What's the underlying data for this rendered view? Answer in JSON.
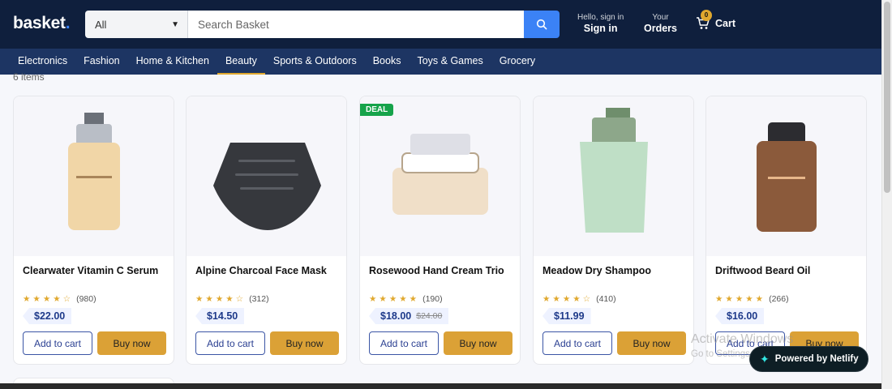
{
  "header": {
    "logo": "basket",
    "logo_dot": ".",
    "search_category": "All",
    "search_placeholder": "Search Basket",
    "account_small": "Hello, sign in",
    "account_big": "Sign in",
    "orders_small": "Your",
    "orders_big": "Orders",
    "cart_count": "0",
    "cart_label": "Cart"
  },
  "nav": {
    "items": [
      "Electronics",
      "Fashion",
      "Home & Kitchen",
      "Beauty",
      "Sports & Outdoors",
      "Books",
      "Toys & Games",
      "Grocery"
    ],
    "active": "Beauty"
  },
  "results": {
    "count_label": "6 items"
  },
  "products": [
    {
      "name": "Clearwater Vitamin C Serum",
      "rating": 4,
      "reviews": "(980)",
      "price": "$22.00",
      "old_price": "",
      "deal": false,
      "add_label": "Add to cart",
      "buy_label": "Buy now"
    },
    {
      "name": "Alpine Charcoal Face Mask",
      "rating": 4,
      "reviews": "(312)",
      "price": "$14.50",
      "old_price": "",
      "deal": false,
      "add_label": "Add to cart",
      "buy_label": "Buy now"
    },
    {
      "name": "Rosewood Hand Cream Trio",
      "rating": 5,
      "reviews": "(190)",
      "price": "$18.00",
      "old_price": "$24.00",
      "deal": true,
      "deal_label": "DEAL",
      "add_label": "Add to cart",
      "buy_label": "Buy now"
    },
    {
      "name": "Meadow Dry Shampoo",
      "rating": 4,
      "reviews": "(410)",
      "price": "$11.99",
      "old_price": "",
      "deal": false,
      "add_label": "Add to cart",
      "buy_label": "Buy now"
    },
    {
      "name": "Driftwood Beard Oil",
      "rating": 5,
      "reviews": "(266)",
      "price": "$16.00",
      "old_price": "",
      "deal": false,
      "add_label": "Add to cart",
      "buy_label": "Buy now"
    }
  ],
  "watermark": {
    "line1": "Activate Windows",
    "line2": "Go to Settings to activate Windows."
  },
  "netlify_badge": "Powered by Netlify",
  "colors": {
    "header_bg": "#0f1f3d",
    "nav_bg": "#1d3563",
    "accent_blue": "#3b82f6",
    "accent_gold": "#dba136",
    "deal_green": "#16a34a"
  }
}
